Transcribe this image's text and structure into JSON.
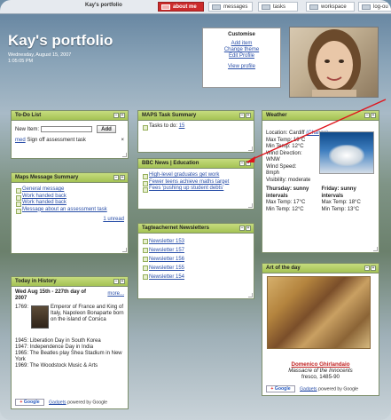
{
  "nav": {
    "brand": "Kay's portfolio",
    "tabs": [
      {
        "label": "about me",
        "active": true
      },
      {
        "label": "messages",
        "active": false
      },
      {
        "label": "tasks",
        "active": false
      },
      {
        "label": "workspace",
        "active": false
      },
      {
        "label": "log-ou",
        "active": false
      }
    ]
  },
  "header": {
    "title": "Kay's portfolio",
    "date_line1": "Wednesday, August 15, 2007",
    "date_line2": "1:05:05 PM"
  },
  "customise": {
    "heading": "Customise",
    "links": [
      "Add item",
      "Change theme",
      "Edit Profile",
      "View profile"
    ]
  },
  "todo": {
    "title": "To-Do List",
    "new_item_label": "New Item:",
    "add_label": "Add",
    "item_tag": "med",
    "item_text": "Sign off assessment task",
    "item_close": "×"
  },
  "maps_task": {
    "title": "MAPS Task Summary",
    "tasks_label": "Tasks to do:",
    "tasks_count": "15"
  },
  "bbc": {
    "title": "BBC News | Education",
    "items": [
      "High-level graduates get work",
      "Fewer teens achieve maths target",
      "Fees 'pushing up student debts'"
    ]
  },
  "maps_msg": {
    "title": "Maps Message Summary",
    "items": [
      "General message",
      "Work handed back",
      "Work handed back",
      "Message about an assessment task"
    ],
    "unread": "1 unread"
  },
  "tagteacher": {
    "title": "Tagteachernet Newsletters",
    "items": [
      "Newsletter 153",
      "Newsletter 157",
      "Newsletter 156",
      "Newsletter 155",
      "Newsletter 154"
    ]
  },
  "weather": {
    "title": "Weather",
    "location_label": "Location:",
    "location": "Cardiff",
    "change": "(Change)",
    "lines": [
      "Max Temp: 19°C",
      "Min Temp: 12°C",
      "Wind Direction:",
      "WNW",
      "Wind Speed:",
      "8mph",
      "Visibility: moderate"
    ],
    "day1_title": "Thursday: sunny intervals",
    "day1_max": "Max Temp: 17°C",
    "day1_min": "Min Temp: 12°C",
    "day2_title": "Friday: sunny intervals",
    "day2_max": "Max Temp: 18°C",
    "day2_min": "Min Temp: 13°C"
  },
  "history": {
    "title": "Today in History",
    "heading_line1": "Wed Aug 15th - 227th day of",
    "heading_line2": "2007",
    "more": "more...",
    "first_year": "1769:",
    "first_text": "Emperor of France and King of Italy, Napoleon Bonaparte born on the island of Corsica",
    "events": [
      "1945: Liberation Day in South Korea",
      "1947: Independence Day in India",
      "1965: The Beatles play Shea Stadium in New York",
      "1969: The Woodstock Music & Arts"
    ],
    "footer_google": "Google",
    "footer_gadgets": "Gadgets",
    "footer_powered": "powered by Google"
  },
  "art": {
    "title": "Art of the day",
    "artist": "Domenico Ghirlandaio",
    "work": "Massacre of the Innocents",
    "medium": "fresco, 1485-90",
    "footer_google": "Google",
    "footer_gadgets": "Gadgets",
    "footer_powered": "powered by Google"
  },
  "colors": {
    "accent": "#a4c254",
    "active_tab": "#cc2b2b",
    "link": "#2a4fa8",
    "arrow": "#e0141c"
  }
}
